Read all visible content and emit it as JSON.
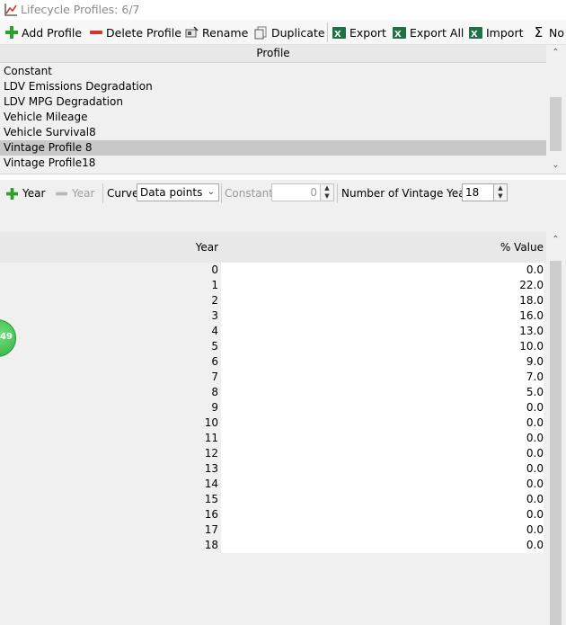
{
  "window": {
    "title": "Lifecycle Profiles: 6/7"
  },
  "toolbar": {
    "add_profile": "Add Profile",
    "delete_profile": "Delete Profile",
    "rename": "Rename",
    "duplicate": "Duplicate",
    "export": "Export",
    "export_all": "Export All",
    "import": "Import",
    "normalize": "No"
  },
  "profiles": {
    "header": "Profile",
    "items": [
      {
        "name": "Constant",
        "selected": false
      },
      {
        "name": "LDV Emissions Degradation",
        "selected": false
      },
      {
        "name": "LDV MPG Degradation",
        "selected": false
      },
      {
        "name": "Vehicle Mileage",
        "selected": false
      },
      {
        "name": "Vehicle Survival8",
        "selected": false
      },
      {
        "name": "Vintage Profile 8",
        "selected": true
      },
      {
        "name": "Vintage Profile18",
        "selected": false
      }
    ]
  },
  "editor": {
    "add_year": "Year",
    "remove_year": "Year",
    "curve_label": "Curve:",
    "curve_value": "Data points",
    "constant_label": "Constant:",
    "constant_value": "0",
    "vintage_label": "Number of Vintage Years:",
    "vintage_value": "18"
  },
  "table": {
    "columns": [
      "Year",
      "% Value"
    ],
    "rows": [
      [
        "0",
        "0.0"
      ],
      [
        "1",
        "22.0"
      ],
      [
        "2",
        "18.0"
      ],
      [
        "3",
        "16.0"
      ],
      [
        "4",
        "13.0"
      ],
      [
        "5",
        "10.0"
      ],
      [
        "6",
        "9.0"
      ],
      [
        "7",
        "7.0"
      ],
      [
        "8",
        "5.0"
      ],
      [
        "9",
        "0.0"
      ],
      [
        "10",
        "0.0"
      ],
      [
        "11",
        "0.0"
      ],
      [
        "12",
        "0.0"
      ],
      [
        "13",
        "0.0"
      ],
      [
        "14",
        "0.0"
      ],
      [
        "15",
        "0.0"
      ],
      [
        "16",
        "0.0"
      ],
      [
        "17",
        "0.0"
      ],
      [
        "18",
        "0.0"
      ]
    ]
  },
  "badge": {
    "text": "49"
  },
  "colors": {
    "add_green": "#2e9e2e",
    "delete_red": "#d9342b",
    "excel_green": "#1e7145",
    "selected_row": "#c8c8c8"
  }
}
